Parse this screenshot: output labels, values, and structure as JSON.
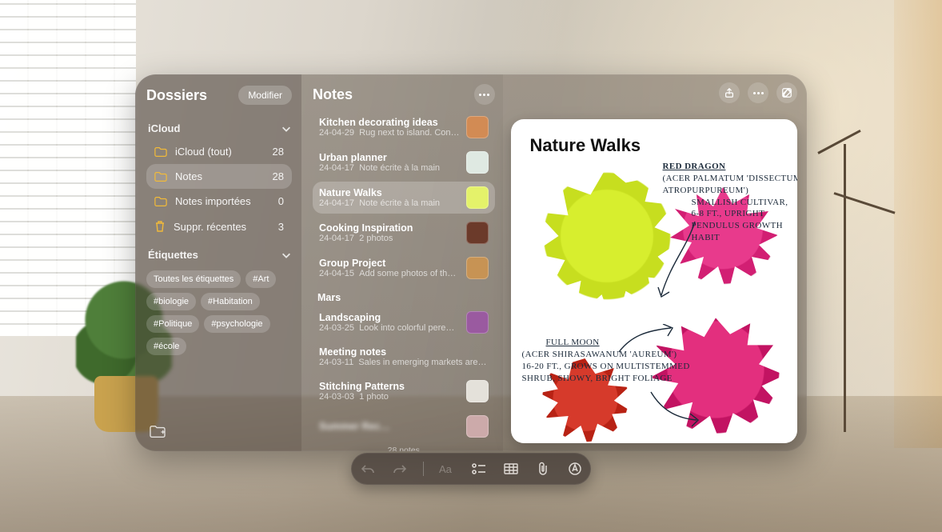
{
  "sidebar": {
    "title": "Dossiers",
    "editButton": "Modifier",
    "sections": {
      "icloud": {
        "label": "iCloud",
        "folders": [
          {
            "name": "iCloud (tout)",
            "count": "28",
            "icon": "folder",
            "selected": false
          },
          {
            "name": "Notes",
            "count": "28",
            "icon": "folder",
            "selected": true
          },
          {
            "name": "Notes importées",
            "count": "0",
            "icon": "folder",
            "selected": false
          },
          {
            "name": "Suppr. récentes",
            "count": "3",
            "icon": "trash",
            "selected": false
          }
        ]
      },
      "tags": {
        "label": "Étiquettes",
        "items": [
          "Toutes les étiquettes",
          "#Art",
          "#biologie",
          "#Habitation",
          "#Politique",
          "#psychologie",
          "#école"
        ]
      }
    }
  },
  "notesColumn": {
    "title": "Notes",
    "countLabel": "28 notes",
    "groups": [
      {
        "header": null,
        "items": [
          {
            "title": "Kitchen decorating ideas",
            "date": "24-04-29",
            "snippet": "Rug next to island. Con…",
            "thumb": "#d28b54",
            "selected": false
          },
          {
            "title": "Urban planner",
            "date": "24-04-17",
            "snippet": "Note écrite à la main",
            "thumb": "#dfe9e2",
            "selected": false
          },
          {
            "title": "Nature Walks",
            "date": "24-04-17",
            "snippet": "Note écrite à la main",
            "thumb": "#e4f26a",
            "selected": true
          },
          {
            "title": "Cooking Inspiration",
            "date": "24-04-17",
            "snippet": "2 photos",
            "thumb": "#6b3a2a",
            "selected": false
          },
          {
            "title": "Group Project",
            "date": "24-04-15",
            "snippet": "Add some photos of th…",
            "thumb": "#c79354",
            "selected": false
          }
        ]
      },
      {
        "header": "Mars",
        "items": [
          {
            "title": "Landscaping",
            "date": "24-03-25",
            "snippet": "Look into colorful pere…",
            "thumb": "#9a5aa0",
            "selected": false
          },
          {
            "title": "Meeting notes",
            "date": "24-03-11",
            "snippet": "Sales in emerging markets are…",
            "thumb": null,
            "selected": false
          },
          {
            "title": "Stitching Patterns",
            "date": "24-03-03",
            "snippet": "1 photo",
            "thumb": "#e4e1da",
            "selected": false
          },
          {
            "title": "Summer Rec…",
            "date": "",
            "snippet": "",
            "thumb": "#caa",
            "selected": false,
            "blurred": true
          }
        ]
      }
    ]
  },
  "detail": {
    "title": "Nature Walks",
    "annotations": {
      "redDragon": {
        "heading": "RED DRAGON",
        "line1": "(ACER PALMATUM 'DISSECTUM ATROPURPUREUM')",
        "line2": "SMALLISH CULTIVAR,",
        "line3": "6-8 FT., UPRIGHT",
        "line4": "PENDULUS GROWTH",
        "line5": "HABIT"
      },
      "fullMoon": {
        "heading": "FULL MOON",
        "line1": "(ACER SHIRASAWANUM 'AUREUM')",
        "line2": "16-20 FT., GROWS ON MULTISTEMMED",
        "line3": "SHRUB, SHOWY, BRIGHT FOLIAGE"
      }
    }
  },
  "colors": {
    "folderIcon": "#f0b93a"
  }
}
